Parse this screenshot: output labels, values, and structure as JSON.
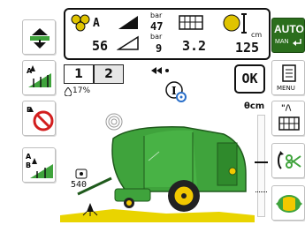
{
  "status_bar": {
    "bale_count": {
      "label": "A",
      "value": "56"
    },
    "pressure": {
      "unit_top": "bar",
      "value_top": "47",
      "unit_bottom": "bar",
      "value_bottom": "9"
    },
    "net_turns": {
      "value": "3.2"
    },
    "bale_diameter": {
      "unit": "cm",
      "value": "125"
    }
  },
  "tabs": [
    {
      "label": "1",
      "active": false
    },
    {
      "label": "2",
      "active": true
    }
  ],
  "ok_button": {
    "label": "OK"
  },
  "moisture": {
    "value": "17%"
  },
  "pto_speed": {
    "value": "540"
  },
  "diameter_scale": {
    "label": "θcm"
  },
  "auto_button": {
    "label": "AUTO",
    "sub_label": "MAN"
  },
  "right_buttons": [
    {
      "name": "menu",
      "label": "MENU"
    },
    {
      "name": "net-settings",
      "label": "\"/\\"
    },
    {
      "name": "knife",
      "label": ""
    },
    {
      "name": "wrap-direction",
      "label": ""
    }
  ],
  "colors": {
    "accent_green": "#2b6e1d",
    "baler_green": "#3fa33c",
    "wheel_yellow": "#f2c800",
    "warning_red": "#d21e1e"
  }
}
